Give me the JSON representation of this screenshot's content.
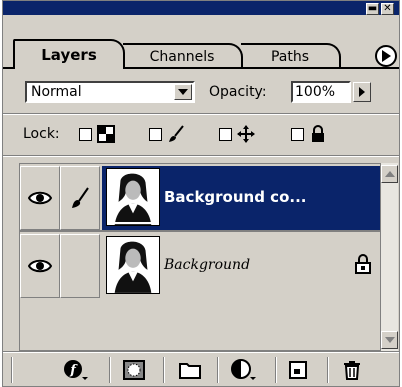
{
  "window": {
    "minimize_glyph": "▬",
    "close_glyph": "✕"
  },
  "tabs": [
    {
      "label": "Layers",
      "active": true
    },
    {
      "label": "Channels",
      "active": false
    },
    {
      "label": "Paths",
      "active": false
    }
  ],
  "blend_mode": {
    "value": "Normal"
  },
  "opacity": {
    "label": "Opacity:",
    "value": "100%"
  },
  "lock": {
    "label": "Lock:",
    "options": [
      {
        "icon": "transparency-lock-icon"
      },
      {
        "icon": "brush-lock-icon"
      },
      {
        "icon": "move-lock-icon"
      },
      {
        "icon": "padlock-icon"
      }
    ]
  },
  "layers": [
    {
      "name": "Background co...",
      "selected": true,
      "visible": true,
      "icon": "brush-icon"
    },
    {
      "name": "Background",
      "selected": false,
      "visible": true,
      "locked": true
    }
  ],
  "bottom_toolbar": [
    "layer-style-icon",
    "mask-icon",
    "new-set-icon",
    "adjustment-layer-icon",
    "new-layer-icon",
    "trash-icon"
  ],
  "colors": {
    "selection": "#0a246a",
    "panel": "#d4d0c8"
  }
}
